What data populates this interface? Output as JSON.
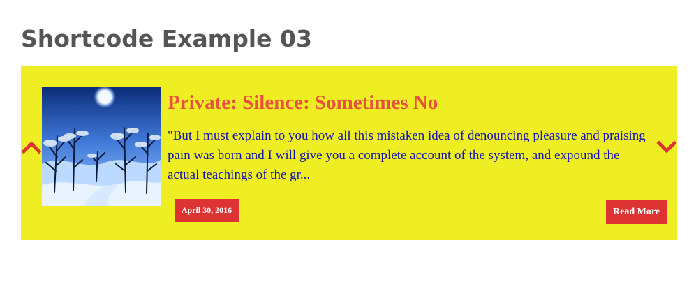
{
  "page": {
    "title": "Shortcode Example 03"
  },
  "slider": {
    "background": "#eeee22",
    "accent": "#dd3333",
    "prev_icon": "chevron-up-icon",
    "next_icon": "chevron-down-icon",
    "post": {
      "title": "Private: Silence: Sometimes No",
      "excerpt": "\"But I must explain to you how all this mistaken idea of denouncing pleasure and praising pain was born and I will give you a complete account of the system, and expound the actual teachings of the gr...",
      "date": "April 30, 2016",
      "read_more_label": "Read More",
      "title_color": "#e8503f",
      "excerpt_color": "#1515b0",
      "thumbnail_icon": "snowy-forest-night-image"
    }
  }
}
